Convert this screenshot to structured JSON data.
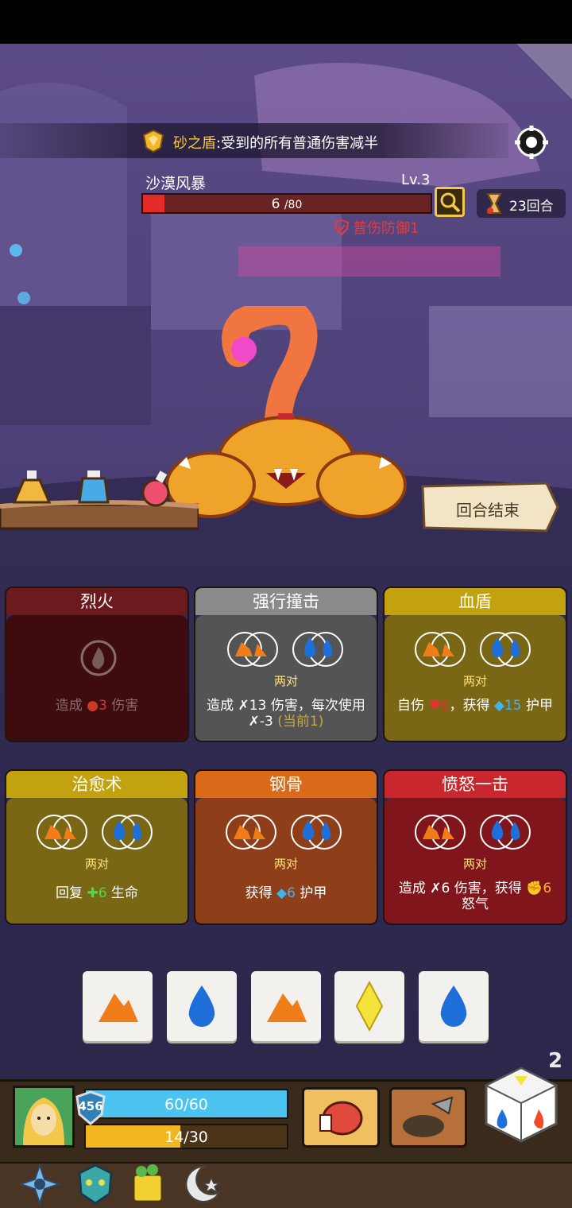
{
  "skill_banner": {
    "name": "砂之盾",
    "separator": ":",
    "text": "受到的所有普通伤害减半",
    "icon": "golden-shield-icon"
  },
  "enemy": {
    "name": "沙漠风暴",
    "level": "Lv.3",
    "hp_current": "6",
    "hp_max": "/80",
    "hp_fraction": 0.075,
    "defense_text": "普伤防御1"
  },
  "round": {
    "text": "23回合"
  },
  "end_turn": {
    "label": "回合结束"
  },
  "potions": [
    "yellow-potion-icon",
    "blue-potion-icon",
    "pink-potion-icon"
  ],
  "cards": [
    {
      "name": "烈火",
      "pair": "",
      "desc_parts": [
        "造成 ",
        "3",
        " 伤害"
      ],
      "color": "red"
    },
    {
      "name": "强行撞击",
      "pair": "两对",
      "desc_line1": "造成 ✗13 伤害，每次使用",
      "desc_line2": "✗-3 ",
      "desc_note": "(当前1)",
      "color": "gray"
    },
    {
      "name": "血盾",
      "pair": "两对",
      "desc_parts": [
        "自伤 ",
        "6",
        "，获得 ",
        "15",
        " 护甲"
      ],
      "color": "gold"
    },
    {
      "name": "治愈术",
      "pair": "两对",
      "desc_parts": [
        "回复 ",
        "6",
        " 生命"
      ],
      "color": "gold"
    },
    {
      "name": "钢骨",
      "pair": "两对",
      "desc_parts": [
        "获得 ",
        "6",
        " 护甲"
      ],
      "color": "orange"
    },
    {
      "name": "愤怒一击",
      "pair": "两对",
      "desc_line1": "造成 ✗6 伤害，获得 ",
      "desc_val": "6",
      "desc_line2": "怒气",
      "color": "crimson"
    }
  ],
  "dice": [
    "earth",
    "water",
    "earth",
    "lightning",
    "water"
  ],
  "die_count": "2",
  "player": {
    "armor": "456",
    "hp": "60/60",
    "hp_fraction": 1.0,
    "rage": "14/30",
    "rage_fraction": 0.47
  },
  "skill_buttons": [
    "fist-skill-icon",
    "dig-skill-icon"
  ],
  "relics": [
    "compass-relic-icon",
    "demon-mask-relic-icon",
    "clover-dice-relic-icon",
    "moon-star-relic-icon"
  ]
}
